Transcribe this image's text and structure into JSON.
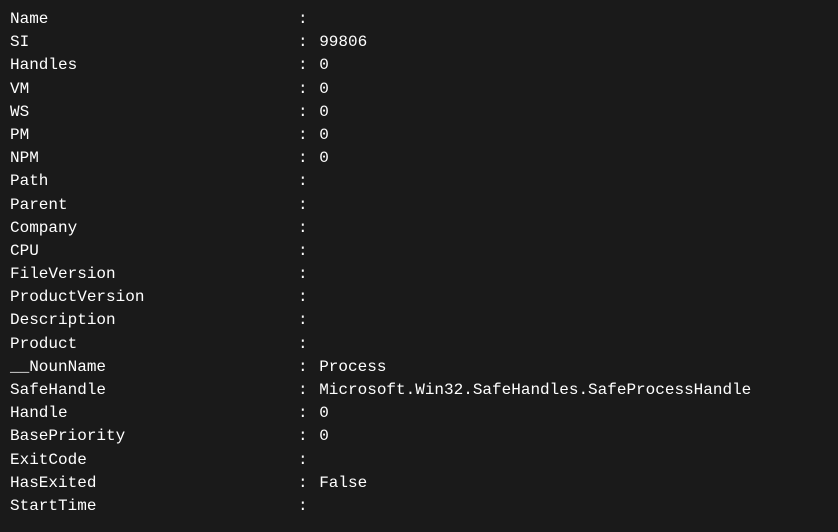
{
  "rows": [
    {
      "key": "Name",
      "value": ""
    },
    {
      "key": "SI",
      "value": "99806"
    },
    {
      "key": "Handles",
      "value": "0"
    },
    {
      "key": "VM",
      "value": "0"
    },
    {
      "key": "WS",
      "value": "0"
    },
    {
      "key": "PM",
      "value": "0"
    },
    {
      "key": "NPM",
      "value": "0"
    },
    {
      "key": "Path",
      "value": ""
    },
    {
      "key": "Parent",
      "value": ""
    },
    {
      "key": "Company",
      "value": ""
    },
    {
      "key": "CPU",
      "value": ""
    },
    {
      "key": "FileVersion",
      "value": ""
    },
    {
      "key": "ProductVersion",
      "value": ""
    },
    {
      "key": "Description",
      "value": ""
    },
    {
      "key": "Product",
      "value": ""
    },
    {
      "key": "__NounName",
      "value": "Process"
    },
    {
      "key": "SafeHandle",
      "value": "Microsoft.Win32.SafeHandles.SafeProcessHandle"
    },
    {
      "key": "Handle",
      "value": "0"
    },
    {
      "key": "BasePriority",
      "value": "0"
    },
    {
      "key": "ExitCode",
      "value": ""
    },
    {
      "key": "HasExited",
      "value": "False"
    },
    {
      "key": "StartTime",
      "value": ""
    }
  ],
  "separator": ": "
}
